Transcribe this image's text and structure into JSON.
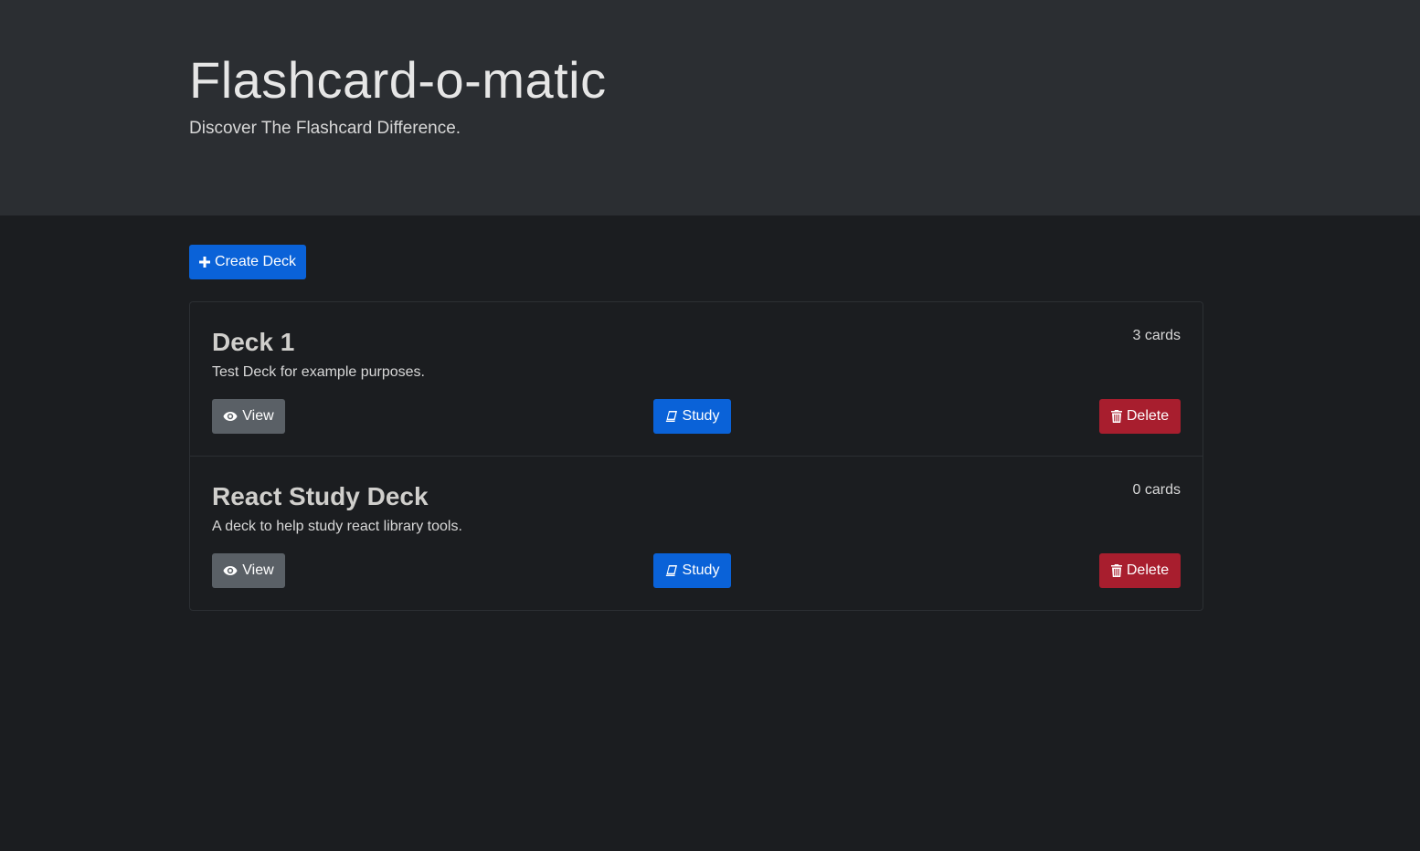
{
  "header": {
    "title": "Flashcard-o-matic",
    "subtitle": "Discover The Flashcard Difference."
  },
  "toolbar": {
    "create_label": "Create Deck",
    "create_icon": "plus-icon"
  },
  "decks": [
    {
      "name": "Deck 1",
      "count": "3 cards",
      "description": "Test Deck for example purposes.",
      "view_label": "View",
      "study_label": "Study",
      "delete_label": "Delete"
    },
    {
      "name": "React Study Deck",
      "count": "0 cards",
      "description": "A deck to help study react library tools.",
      "view_label": "View",
      "study_label": "Study",
      "delete_label": "Delete"
    }
  ],
  "colors": {
    "header_bg": "#2b2e32",
    "page_bg": "#1b1d20",
    "primary": "#0a62d8",
    "secondary": "#5a6066",
    "danger": "#a81e2e"
  },
  "icons": {
    "view": "eye-icon",
    "study": "book-icon",
    "delete": "trash-icon"
  }
}
